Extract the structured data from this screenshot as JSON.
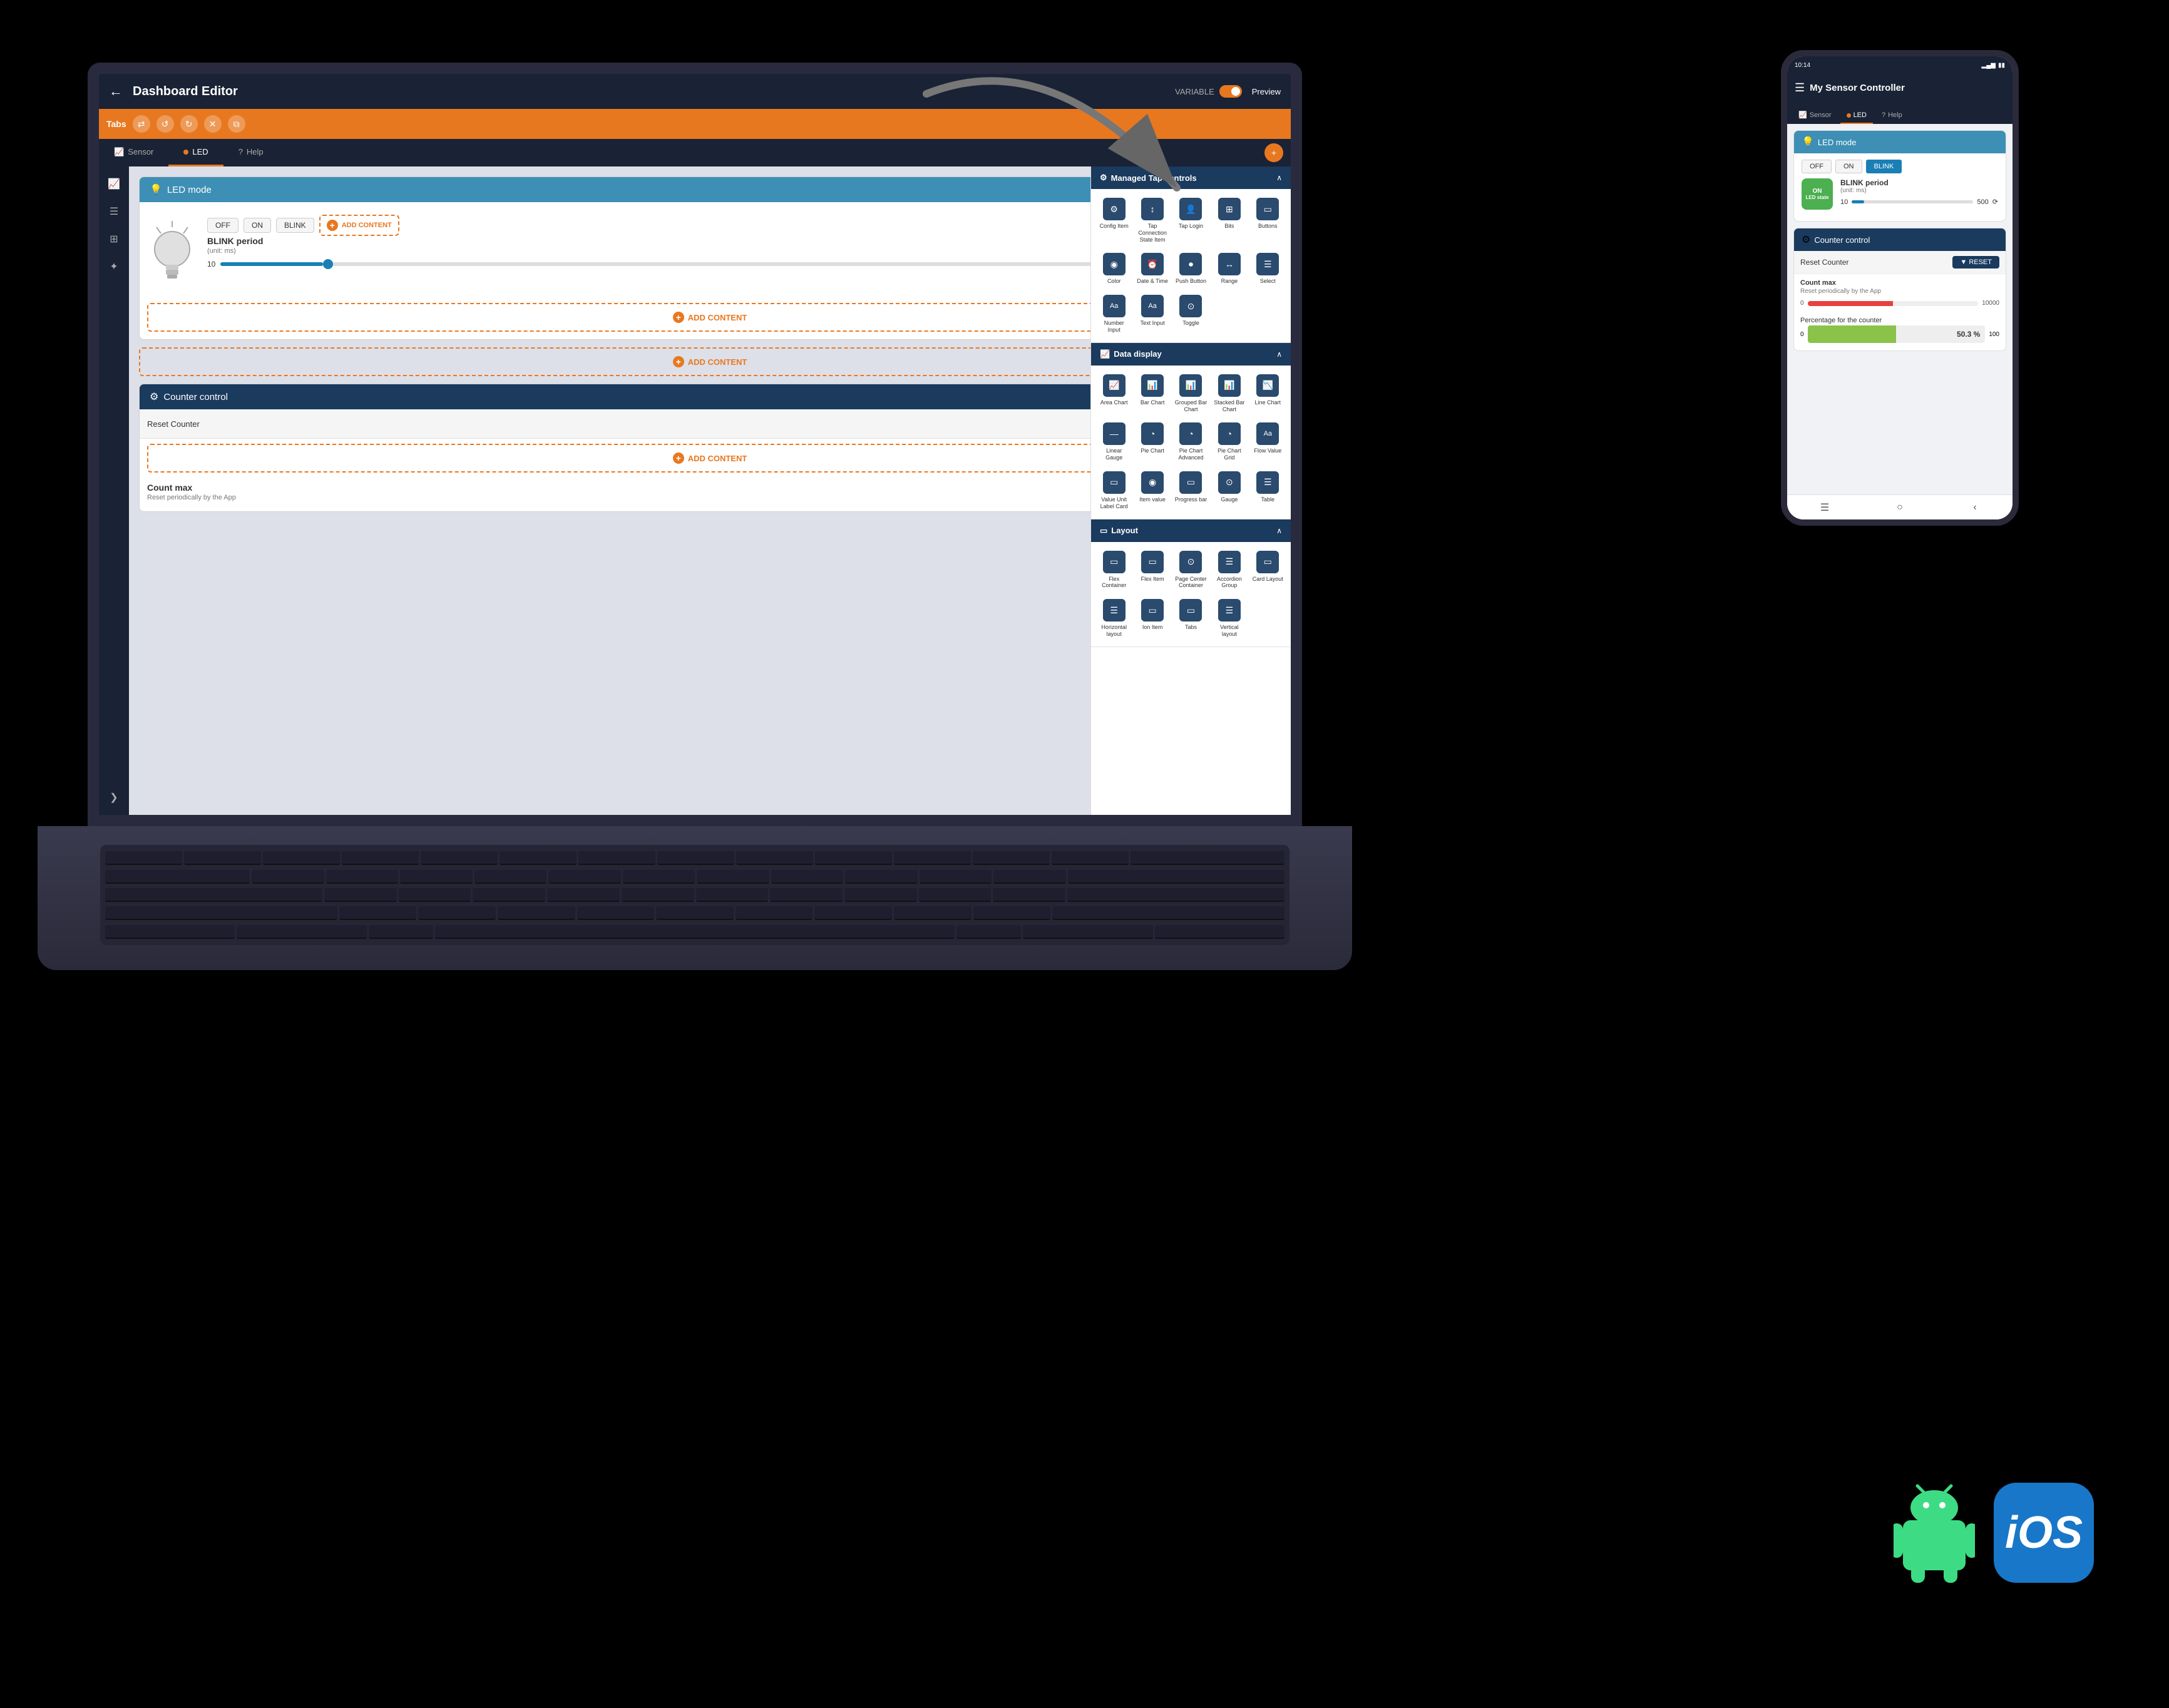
{
  "app": {
    "title": "Dashboard Editor",
    "back_label": "←",
    "variable_label": "VARIABLE",
    "preview_label": "Preview"
  },
  "toolbar": {
    "tabs_label": "Tabs",
    "sync_icon": "⇄",
    "add_icon": "+"
  },
  "editor_tabs": [
    {
      "label": "Sensor",
      "active": false
    },
    {
      "label": "LED",
      "active": true
    },
    {
      "label": "Help",
      "active": false
    }
  ],
  "sidebar_icons": [
    {
      "name": "chart-icon",
      "symbol": "📈",
      "active": true
    },
    {
      "name": "layers-icon",
      "symbol": "☰",
      "active": false
    },
    {
      "name": "stack-icon",
      "symbol": "⊞",
      "active": false
    },
    {
      "name": "puzzle-icon",
      "symbol": "✦",
      "active": false
    },
    {
      "name": "chevron-right-icon",
      "symbol": "❯",
      "active": false
    }
  ],
  "widgets": {
    "led_mode": {
      "title": "LED mode",
      "buttons": [
        "OFF",
        "ON",
        "BLINK"
      ],
      "blink_period_label": "BLINK period",
      "blink_period_unit": "(unit: ms)",
      "slider_min": "10",
      "slider_max": "500",
      "add_content_label": "ADD CONTENT"
    },
    "counter_control": {
      "title": "Counter control",
      "reset_label": "Reset Counter",
      "reset_btn_label": "▼ RESET",
      "add_content_label": "ADD CONTENT",
      "count_max_label": "Count max",
      "count_max_sub": "Reset periodically by the App"
    }
  },
  "add_content_panel": {
    "sections": [
      {
        "title": "Managed Tap controls",
        "icon": "⚙",
        "items": [
          {
            "label": "Config Item",
            "icon": "⚙"
          },
          {
            "label": "Tap Connection State Item",
            "icon": "↕"
          },
          {
            "label": "Tap Login",
            "icon": "👤"
          },
          {
            "label": "Bits",
            "icon": "⊞"
          },
          {
            "label": "Buttons",
            "icon": "▭"
          }
        ],
        "items2": [
          {
            "label": "Color",
            "icon": "◉"
          },
          {
            "label": "Date & Time",
            "icon": "⏰"
          },
          {
            "label": "Push Button",
            "icon": "⏺"
          },
          {
            "label": "Range",
            "icon": "↔"
          },
          {
            "label": "Select",
            "icon": "☰"
          }
        ],
        "items3": [
          {
            "label": "Number Input",
            "icon": "Aa"
          },
          {
            "label": "Text Input",
            "icon": "Aa"
          },
          {
            "label": "Toggle",
            "icon": "⊙"
          }
        ]
      },
      {
        "title": "Data display",
        "icon": "📈",
        "items": [
          {
            "label": "Area Chart",
            "icon": "📈"
          },
          {
            "label": "Bar Chart",
            "icon": "📊"
          },
          {
            "label": "Grouped Bar Chart",
            "icon": "📊"
          },
          {
            "label": "Stacked Bar Chart",
            "icon": "📊"
          },
          {
            "label": "Line Chart",
            "icon": "📉"
          }
        ],
        "items2": [
          {
            "label": "Linear Gauge",
            "icon": "—"
          },
          {
            "label": "Pie Chart",
            "icon": "◔"
          },
          {
            "label": "Pie Chart Advanced",
            "icon": "◔"
          },
          {
            "label": "Pie Chart Grid",
            "icon": "◔"
          },
          {
            "label": "Flow Value",
            "icon": "Aa"
          }
        ],
        "items3": [
          {
            "label": "Value Unit Label Card",
            "icon": "▭"
          },
          {
            "label": "Item value",
            "icon": "◉"
          },
          {
            "label": "Progress bar",
            "icon": "▭"
          },
          {
            "label": "Gauge",
            "icon": "⊙"
          },
          {
            "label": "Table",
            "icon": "☰"
          }
        ]
      },
      {
        "title": "Layout",
        "icon": "▭",
        "items": [
          {
            "label": "Flex Container",
            "icon": "▭"
          },
          {
            "label": "Flex Item",
            "icon": "▭"
          },
          {
            "label": "Page Center Container",
            "icon": "⊙"
          },
          {
            "label": "Accordion Group",
            "icon": "☰"
          },
          {
            "label": "Card Layout",
            "icon": "▭"
          }
        ],
        "items2": [
          {
            "label": "Horizontal layout",
            "icon": "☰"
          },
          {
            "label": "Ion Item",
            "icon": "▭"
          },
          {
            "label": "Tabs",
            "icon": "▭"
          },
          {
            "label": "Vertical layout",
            "icon": "☰"
          }
        ]
      }
    ]
  },
  "phone": {
    "status_bar": {
      "time": "10:14",
      "battery": "▮▮▮",
      "signal": "▂▄▆"
    },
    "app_title": "My Sensor Controller",
    "tabs": [
      "Sensor",
      "LED",
      "Help"
    ],
    "active_tab": "LED",
    "led_widget": {
      "title": "LED mode",
      "buttons": [
        "OFF",
        "ON",
        "BLINK"
      ],
      "active_button": "BLINK",
      "on_state_label": "ON",
      "led_state_label": "LED state",
      "blink_period_label": "BLINK period",
      "blink_unit": "(unit: ms)",
      "slider_min": "10",
      "slider_max": "500"
    },
    "counter_widget": {
      "title": "Counter control",
      "reset_label": "Reset Counter",
      "reset_btn": "▼ RESET",
      "count_max_label": "Count max",
      "count_max_sub": "Reset periodically by the App",
      "range_min": "0",
      "range_max": "10000",
      "pct_label": "Percentage for the counter",
      "pct_min": "0",
      "pct_max": "100",
      "pct_value": "50.3 %"
    }
  },
  "platforms": {
    "android_label": "Android",
    "ios_label": "iOS"
  }
}
